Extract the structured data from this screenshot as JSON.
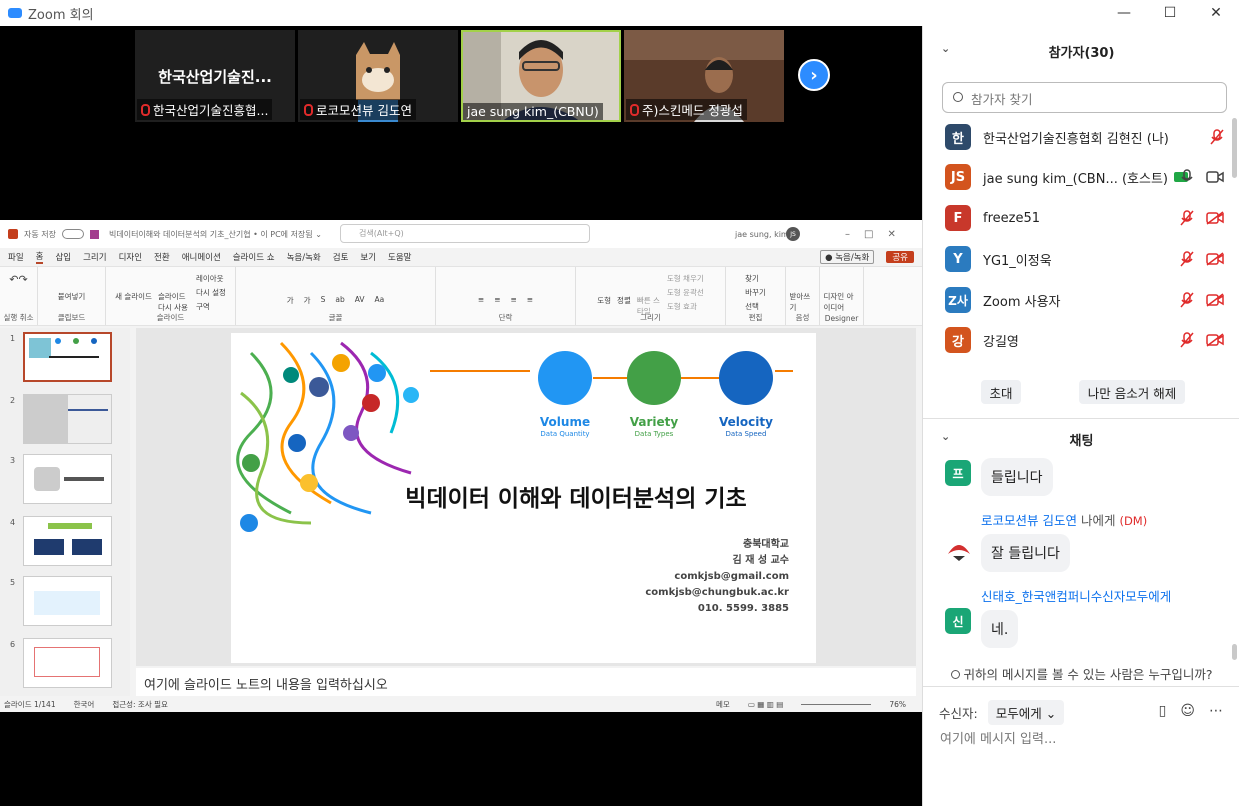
{
  "window": {
    "title": "Zoom 회의"
  },
  "video_strip": {
    "tiles": [
      {
        "big_name": "한국산업기술진...",
        "label": "한국산업기술진흥협..."
      },
      {
        "big_name": "",
        "label": "로코모션뷰 김도연"
      },
      {
        "big_name": "",
        "label": "jae sung kim_(CBNU)"
      },
      {
        "big_name": "",
        "label": "주)스킨메드 정광섭"
      }
    ],
    "next": "›"
  },
  "ppt": {
    "autosave": "자동 저장",
    "doc_title": "빅데이터이해와 데이터분석의 기초_산기협 • 이 PC에 저장됨 ⌄",
    "search": "검색(Alt+Q)",
    "user": "jae sung, kim",
    "user_initials": "JS",
    "menu": [
      "파일",
      "홈",
      "삽입",
      "그리기",
      "디자인",
      "전환",
      "애니메이션",
      "슬라이드 쇼",
      "녹음/녹화",
      "검토",
      "보기",
      "도움말"
    ],
    "record_btn": "● 녹음/녹화",
    "share_btn": "공유",
    "ribbon_groups": [
      {
        "name": "실행 취소",
        "buttons": [
          "↶",
          "↷"
        ]
      },
      {
        "name": "클립보드",
        "buttons": [
          "붙여넣기"
        ]
      },
      {
        "name": "슬라이드",
        "buttons": [
          "새 슬라이드",
          "슬라이드 다시 사용",
          "레이아웃",
          "다시 설정",
          "구역"
        ]
      },
      {
        "name": "글꼴",
        "buttons": [
          "가",
          "가",
          "S",
          "ab",
          "AV",
          "Aa"
        ]
      },
      {
        "name": "단락",
        "buttons": [
          "≡",
          "≡",
          "≡",
          "≡"
        ]
      },
      {
        "name": "그리기",
        "buttons": [
          "도형",
          "정렬",
          "빠른 스타일",
          "도형 채우기",
          "도형 윤곽선",
          "도형 효과"
        ]
      },
      {
        "name": "편집",
        "buttons": [
          "찾기",
          "바꾸기",
          "선택"
        ]
      },
      {
        "name": "음성",
        "buttons": [
          "받아쓰기"
        ]
      },
      {
        "name": "Designer",
        "buttons": [
          "디자인 아이디어"
        ]
      }
    ],
    "thumb_numbers": [
      "1",
      "2",
      "3",
      "4",
      "5",
      "6"
    ],
    "slide": {
      "title": "빅데이터 이해와 데이터분석의 기초",
      "v1": "Volume",
      "v1s": "Data Quantity",
      "v2": "Variety",
      "v2s": "Data Types",
      "v3": "Velocity",
      "v3s": "Data Speed",
      "info": [
        "충북대학교",
        "김 재 성 교수",
        "comkjsb@gmail.com",
        "comkjsb@chungbuk.ac.kr",
        "010. 5599. 3885"
      ]
    },
    "notes": "여기에 슬라이드 노트의 내용을 입력하십시오",
    "status": {
      "slide": "슬라이드 1/141",
      "lang": "한국어",
      "access": "접근성: 조사 필요",
      "memo": "메모",
      "zoom": "76%"
    }
  },
  "participants": {
    "header": "참가자(30)",
    "search_placeholder": "참가자 찾기",
    "list": [
      {
        "initial": "한",
        "name": "한국산업기술진흥협회 김현진 (나)",
        "color": "#2e4a6a"
      },
      {
        "initial": "JS",
        "name": "jae sung kim_(CBN... (호스트)",
        "color": "#d3541e"
      },
      {
        "initial": "F",
        "name": "freeze51",
        "color": "#c8382b"
      },
      {
        "initial": "Y",
        "name": "YG1_이정욱",
        "color": "#2b7bbf"
      },
      {
        "initial": "Z사",
        "name": "Zoom 사용자",
        "color": "#2b7bbf"
      },
      {
        "initial": "강",
        "name": "강길영",
        "color": "#d3541e"
      }
    ],
    "invite": "초대",
    "unmute": "나만 음소거 해제"
  },
  "chat": {
    "header": "채팅",
    "messages": [
      {
        "avatar": "프",
        "text": "들립니다"
      },
      {
        "from": "로코모션뷰 김도연",
        "to": "나에게",
        "dm": "(DM)",
        "text": "잘 들립니다"
      },
      {
        "avatar": "신",
        "from": "신태호_한국앤컴퍼니수신자",
        "to": "모두에게",
        "text": "네."
      }
    ],
    "who_can_see": "귀하의 메시지를 볼 수 있는 사람은 누구입니까?",
    "to_label": "수신자:",
    "to_value": "모두에게",
    "placeholder": "여기에 메시지 입력..."
  },
  "colors": {
    "zoom_blue": "#2d8cff",
    "mute_red": "#e02b2b",
    "ppt_accent": "#b7472a"
  }
}
